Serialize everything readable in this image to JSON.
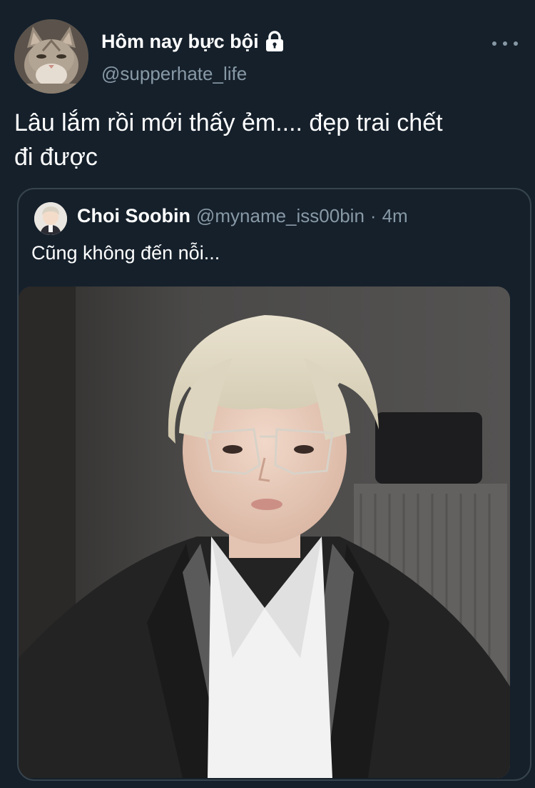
{
  "author": {
    "display_name": "Hôm nay bực bội",
    "handle": "@supperhate_life",
    "avatar_icon": "cat-avatar",
    "protected_icon": "lock-icon"
  },
  "tweet": {
    "text": "Lâu lắm rồi mới thấy ẻm.... đẹp trai chết\nđi được"
  },
  "quoted_tweet": {
    "display_name": "Choi Soobin",
    "handle": "@myname_iss00bin",
    "separator": "·",
    "time": "4m",
    "text": "Cũng không đến nỗi...",
    "avatar_icon": "person-avatar",
    "photo": "photo-of-blond-person-with-glasses"
  },
  "menu_icon": "more-icon",
  "colors": {
    "background": "#15202b",
    "secondary_text": "#8899a6",
    "border": "#38444d"
  }
}
